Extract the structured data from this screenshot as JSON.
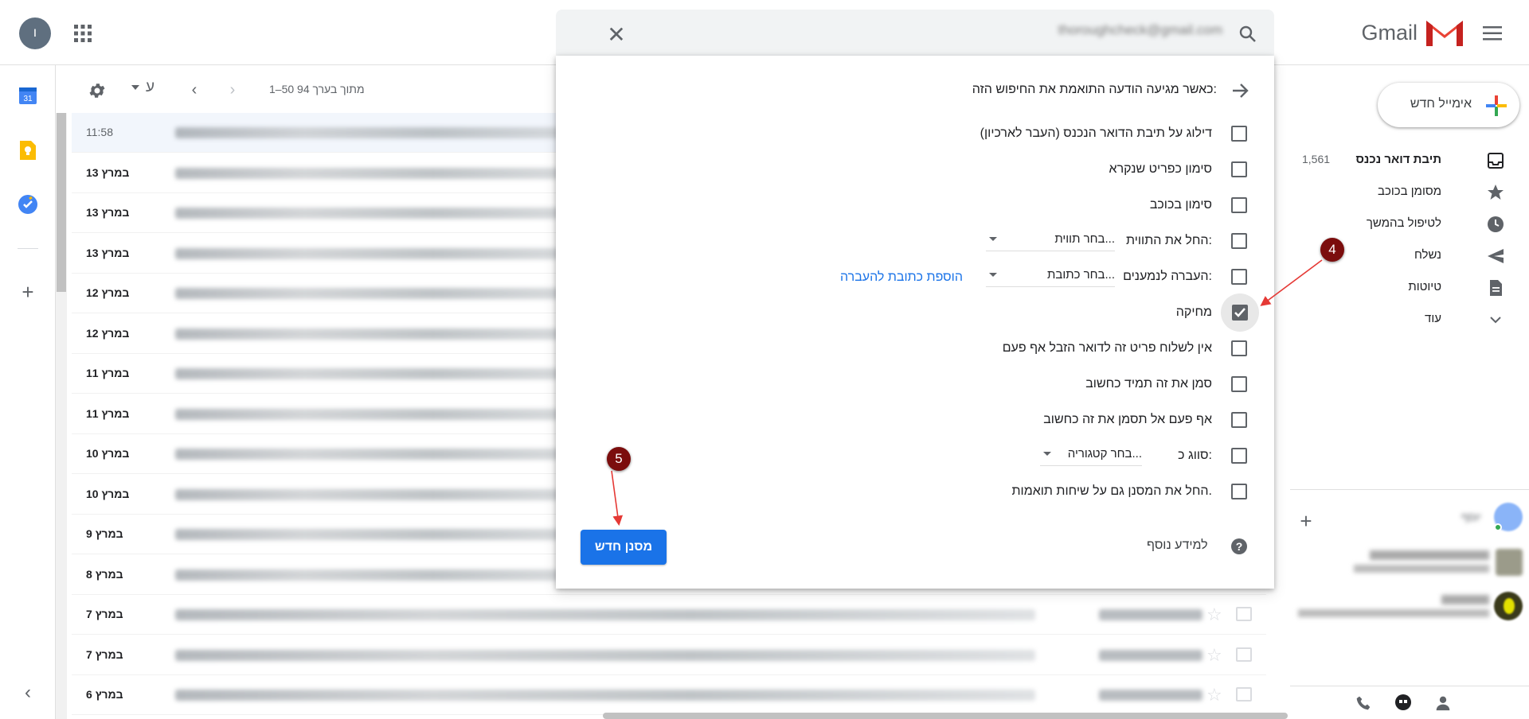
{
  "header": {
    "avatar_letter": "ו",
    "app_name": "Gmail",
    "search_value": "thoroughcheck@gmail.com"
  },
  "sidebar": {
    "compose_label": "אימייל חדש",
    "items": [
      {
        "label": "תיבת דואר נכנס",
        "icon": "inbox-icon",
        "count": "1,561"
      },
      {
        "label": "מסומן בכוכב",
        "icon": "star-icon"
      },
      {
        "label": "לטיפול בהמשך",
        "icon": "clock-icon"
      },
      {
        "label": "נשלח",
        "icon": "send-icon"
      },
      {
        "label": "טיוטות",
        "icon": "draft-icon"
      },
      {
        "label": "עוד",
        "icon": "chevron-down-icon"
      }
    ],
    "chat_user": "יוסף"
  },
  "toolbar": {
    "lang_label": "ע",
    "pagination": "1–50 מתוך בערך 94"
  },
  "emails": {
    "dates": [
      "11:58",
      "13 במרץ",
      "13 במרץ",
      "13 במרץ",
      "12 במרץ",
      "12 במרץ",
      "11 במרץ",
      "11 במרץ",
      "10 במרץ",
      "10 במרץ",
      "9 במרץ",
      "8 במרץ",
      "7 במרץ",
      "7 במרץ",
      "6 במרץ"
    ]
  },
  "filter": {
    "heading": "כאשר מגיעה הודעה התואמת את החיפוש הזה:",
    "options": [
      {
        "label": "דילוג על תיבת הדואר הנכנס (העבר לארכיון)",
        "checked": false
      },
      {
        "label": "סימון כפריט שנקרא",
        "checked": false
      },
      {
        "label": "סימון בכוכב",
        "checked": false
      },
      {
        "label": "החל את התווית:",
        "checked": false,
        "select": "בחר תווית..."
      },
      {
        "label": "העברה לנמענים:",
        "checked": false,
        "select": "בחר כתובת..."
      },
      {
        "label": "מחיקה",
        "checked": true
      },
      {
        "label": "אין לשלוח פריט זה לדואר הזבל אף פעם",
        "checked": false
      },
      {
        "label": "סמן את זה תמיד כחשוב",
        "checked": false
      },
      {
        "label": "אף פעם אל תסמן את זה כחשוב",
        "checked": false
      },
      {
        "label": "סווג כ:",
        "checked": false,
        "select": "בחר קטגוריה..."
      },
      {
        "label": "החל את המסנן גם על שיחות תואמות.",
        "checked": false
      }
    ],
    "add_forward_link": "הוספת כתובת להעברה",
    "learn_more": "למידע נוסף",
    "create_button": "מסנן חדש"
  },
  "annotations": {
    "step4": "4",
    "step5": "5",
    "color": "#7b0d0d"
  }
}
